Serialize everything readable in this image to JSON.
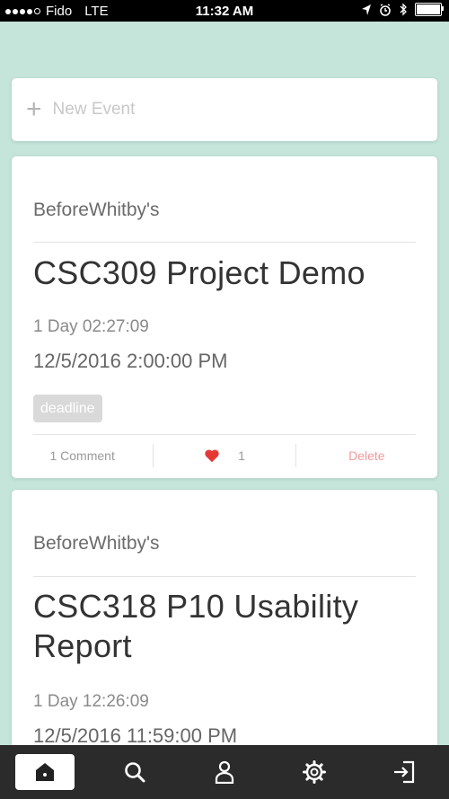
{
  "status_bar": {
    "carrier": "Fido",
    "network": "LTE",
    "time": "11:32 AM",
    "battery_level": 1.0
  },
  "new_event": {
    "label": "New Event",
    "icon": "plus-icon"
  },
  "events": [
    {
      "author": "BeforeWhitby's",
      "title": "CSC309 Project Demo",
      "countdown": "1 Day 02:27:09",
      "datetime": "12/5/2016 2:00:00 PM",
      "tag": "deadline",
      "comments": "1 Comment",
      "likes": "1",
      "delete": "Delete"
    },
    {
      "author": "BeforeWhitby's",
      "title": "CSC318 P10 Usability Report",
      "countdown": "1 Day 12:26:09",
      "datetime": "12/5/2016 11:59:00 PM"
    }
  ],
  "tab_bar": {
    "tabs": [
      "home-icon",
      "search-icon",
      "profile-icon",
      "gear-icon",
      "logout-icon"
    ],
    "active": "home-icon",
    "background": "#2b2b2b"
  },
  "colors": {
    "background": "#c5e5da",
    "heart": "#e53935",
    "delete": "#f09a9a"
  }
}
